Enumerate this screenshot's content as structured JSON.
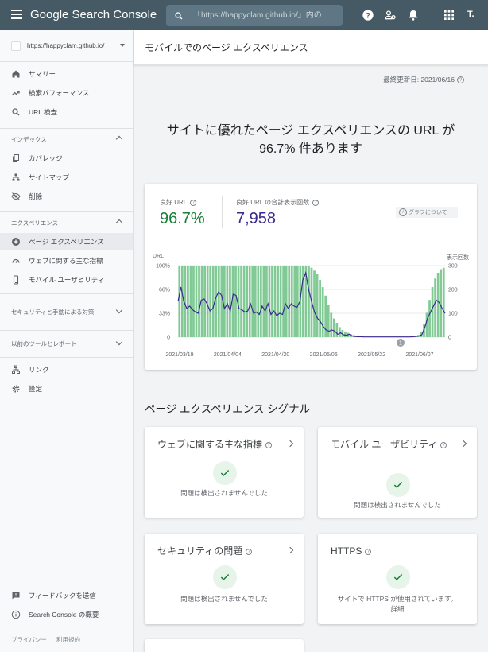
{
  "app": {
    "title": "Google Search Console",
    "search_placeholder": "「https://happyclam.github.io/」内の",
    "user_initial": "T."
  },
  "sidebar": {
    "property": "https://happyclam.github.io/",
    "items_top": [
      {
        "label": "サマリー",
        "icon": "home-icon"
      },
      {
        "label": "検索パフォーマンス",
        "icon": "trending-up-icon"
      },
      {
        "label": "URL 検査",
        "icon": "search-icon"
      }
    ],
    "index_header": "インデックス",
    "index_items": [
      {
        "label": "カバレッジ",
        "icon": "copy-icon"
      },
      {
        "label": "サイトマップ",
        "icon": "sitemap-icon"
      },
      {
        "label": "削除",
        "icon": "eye-off-icon"
      }
    ],
    "experience_header": "エクスペリエンス",
    "experience_items": [
      {
        "label": "ページ エクスペリエンス",
        "icon": "plus-circle-icon"
      },
      {
        "label": "ウェブに関する主な指標",
        "icon": "speed-icon"
      },
      {
        "label": "モバイル ユーザビリティ",
        "icon": "phone-icon"
      }
    ],
    "security_header": "セキュリティと手動による対策",
    "legacy_header": "以前のツールとレポート",
    "bottom_items": [
      {
        "label": "リンク",
        "icon": "links-icon"
      },
      {
        "label": "設定",
        "icon": "gear-icon"
      }
    ],
    "feedback": "フィードバックを送信",
    "about": "Search Console の概要",
    "privacy": "プライバシー",
    "terms": "利用規約"
  },
  "main": {
    "page_title": "モバイルでのページ エクスペリエンス",
    "last_updated": "最終更新日: 2021/06/16",
    "headline_line1": "サイトに優れたページ エクスペリエンスの URL が",
    "headline_line2": "96.7% 件あります",
    "good_url_label": "良好 URL",
    "good_url_value": "96.7%",
    "impressions_label": "良好 URL の合計表示回数",
    "impressions_value": "7,958",
    "about_graph": "グラフについて",
    "signals_title": "ページ エクスペリエンス シグナル",
    "signals": [
      {
        "title": "ウェブに関する主な指標",
        "status": "問題は検出されませんでした"
      },
      {
        "title": "モバイル ユーザビリティ",
        "status": "問題は検出されませんでした"
      },
      {
        "title": "セキュリティの問題",
        "status": "問題は検出されませんでした"
      },
      {
        "title": "HTTPS",
        "status": "サイトで HTTPS が使用されています。",
        "link": "詳細"
      }
    ]
  },
  "colors": {
    "topbar": "#455a64",
    "good_green": "#188038",
    "bar_green": "#81c995",
    "impressions_blue": "#3b2a8c"
  },
  "chart_data": {
    "type": "bar",
    "left_axis_label": "URL",
    "right_axis_label": "表示回数",
    "left_ticks": [
      "100%",
      "66%",
      "33%",
      "0"
    ],
    "right_ticks": [
      "300",
      "200",
      "100",
      "0"
    ],
    "x_ticks": [
      "2021/03/19",
      "2021/04/04",
      "2021/04/20",
      "2021/05/06",
      "2021/05/22",
      "2021/06/07"
    ],
    "annotation": "1",
    "series": [
      {
        "name": "良好 URL",
        "values": [
          100,
          100,
          100,
          100,
          100,
          100,
          100,
          100,
          100,
          100,
          100,
          100,
          100,
          100,
          100,
          100,
          100,
          100,
          100,
          100,
          100,
          100,
          100,
          100,
          100,
          100,
          100,
          100,
          100,
          100,
          100,
          100,
          100,
          100,
          100,
          100,
          100,
          100,
          100,
          100,
          100,
          100,
          100,
          100,
          100,
          100,
          100,
          97,
          93,
          88,
          80,
          70,
          58,
          45,
          34,
          26,
          20,
          14,
          10,
          8,
          6,
          4,
          3,
          2,
          1,
          0,
          0,
          0,
          0,
          0,
          0,
          0,
          0,
          0,
          0,
          0,
          0,
          0,
          0,
          0,
          0,
          0,
          0,
          0,
          0,
          3,
          8,
          18,
          34,
          52,
          70,
          82,
          90,
          95,
          97
        ]
      },
      {
        "name": "良好 URL の合計表示回数",
        "values": [
          150,
          210,
          150,
          120,
          130,
          115,
          105,
          100,
          155,
          160,
          140,
          110,
          120,
          165,
          190,
          175,
          120,
          140,
          110,
          180,
          175,
          120,
          115,
          105,
          110,
          140,
          100,
          105,
          95,
          130,
          110,
          140,
          95,
          110,
          90,
          100,
          95,
          140,
          120,
          140,
          130,
          125,
          150,
          240,
          270,
          200,
          150,
          105,
          80,
          65,
          45,
          30,
          25,
          30,
          25,
          12,
          18,
          10,
          8,
          12,
          5,
          3,
          2,
          2,
          1,
          1,
          1,
          1,
          1,
          1,
          1,
          1,
          1,
          1,
          1,
          1,
          1,
          1,
          1,
          1,
          1,
          2,
          3,
          5,
          10,
          40,
          80,
          105,
          130,
          155,
          145,
          120,
          100
        ]
      }
    ]
  }
}
